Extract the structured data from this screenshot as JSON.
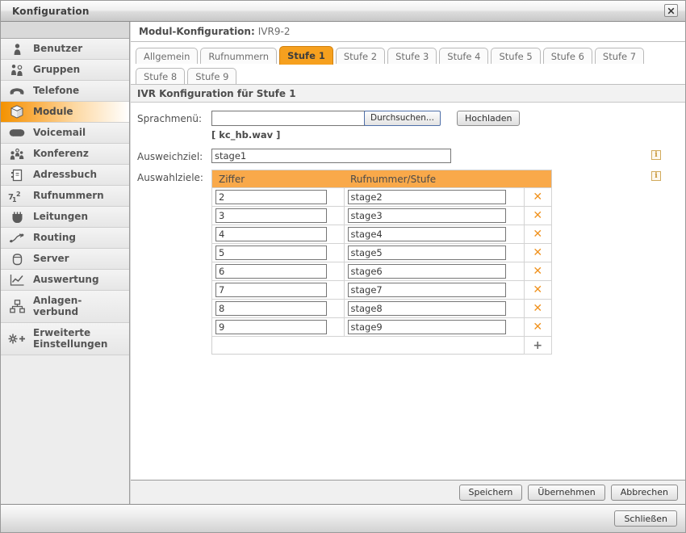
{
  "window": {
    "title": "Konfiguration",
    "close_label": "x",
    "close_icon": "close-icon"
  },
  "sidebar": {
    "items": [
      {
        "label": "Benutzer",
        "icon": "user-icon",
        "active": false
      },
      {
        "label": "Gruppen",
        "icon": "group-icon",
        "active": false
      },
      {
        "label": "Telefone",
        "icon": "phone-icon",
        "active": false
      },
      {
        "label": "Module",
        "icon": "module-cube-icon",
        "active": true
      },
      {
        "label": "Voicemail",
        "icon": "voicemail-icon",
        "active": false
      },
      {
        "label": "Konferenz",
        "icon": "conference-icon",
        "active": false
      },
      {
        "label": "Adressbuch",
        "icon": "addressbook-icon",
        "active": false
      },
      {
        "label": "Rufnummern",
        "icon": "numbers-icon",
        "active": false
      },
      {
        "label": "Leitungen",
        "icon": "lines-icon",
        "active": false
      },
      {
        "label": "Routing",
        "icon": "routing-icon",
        "active": false
      },
      {
        "label": "Server",
        "icon": "server-icon",
        "active": false
      },
      {
        "label": "Auswertung",
        "icon": "chart-icon",
        "active": false
      },
      {
        "label": "Anlagen-\nverbund",
        "icon": "network-icon",
        "active": false
      },
      {
        "label": "Erweiterte\nEinstellungen",
        "icon": "advanced-settings-icon",
        "active": false
      }
    ]
  },
  "main": {
    "header_label": "Modul-Konfiguration:",
    "header_value": "IVR9-2",
    "tabs_row1": [
      {
        "label": "Allgemein",
        "active": false
      },
      {
        "label": "Rufnummern",
        "active": false
      },
      {
        "label": "Stufe 1",
        "active": true
      },
      {
        "label": "Stufe 2",
        "active": false
      },
      {
        "label": "Stufe 3",
        "active": false
      },
      {
        "label": "Stufe 4",
        "active": false
      },
      {
        "label": "Stufe 5",
        "active": false
      },
      {
        "label": "Stufe 6",
        "active": false
      },
      {
        "label": "Stufe 7",
        "active": false
      }
    ],
    "tabs_row2": [
      {
        "label": "Stufe 8",
        "active": false
      },
      {
        "label": "Stufe 9",
        "active": false
      }
    ],
    "panel_title": "IVR Konfiguration für Stufe 1",
    "form": {
      "sprachmenue_label": "Sprachmenü:",
      "sprachmenue_value": "",
      "sprachmenue_placeholder": "",
      "browse_label": "Durchsuchen...",
      "upload_label": "Hochladen",
      "filename": "[ kc_hb.wav ]",
      "ausweichziel_label": "Ausweichziel:",
      "ausweichziel_value": "stage1",
      "auswahlziele_label": "Auswahlziele:",
      "info_icon": "info-icon"
    },
    "table": {
      "headers": [
        "Ziffer",
        "Rufnummer/Stufe"
      ],
      "rows": [
        {
          "ziffer": "2",
          "ziel": "stage2",
          "delete_icon": "delete-icon"
        },
        {
          "ziffer": "3",
          "ziel": "stage3",
          "delete_icon": "delete-icon"
        },
        {
          "ziffer": "4",
          "ziel": "stage4",
          "delete_icon": "delete-icon"
        },
        {
          "ziffer": "5",
          "ziel": "stage5",
          "delete_icon": "delete-icon"
        },
        {
          "ziffer": "6",
          "ziel": "stage6",
          "delete_icon": "delete-icon"
        },
        {
          "ziffer": "7",
          "ziel": "stage7",
          "delete_icon": "delete-icon"
        },
        {
          "ziffer": "8",
          "ziel": "stage8",
          "delete_icon": "delete-icon"
        },
        {
          "ziffer": "9",
          "ziel": "stage9",
          "delete_icon": "delete-icon"
        }
      ],
      "add_label": "+",
      "delete_label": "✕"
    },
    "footer_buttons": [
      {
        "label": "Speichern"
      },
      {
        "label": "Übernehmen"
      },
      {
        "label": "Abbrechen"
      }
    ]
  },
  "window_footer": {
    "close_label": "Schließen"
  },
  "colors": {
    "accent_orange": "#f6a01e",
    "table_header": "#f9a94a",
    "delete_x": "#f0921e",
    "info_border": "#d2ab5e"
  }
}
